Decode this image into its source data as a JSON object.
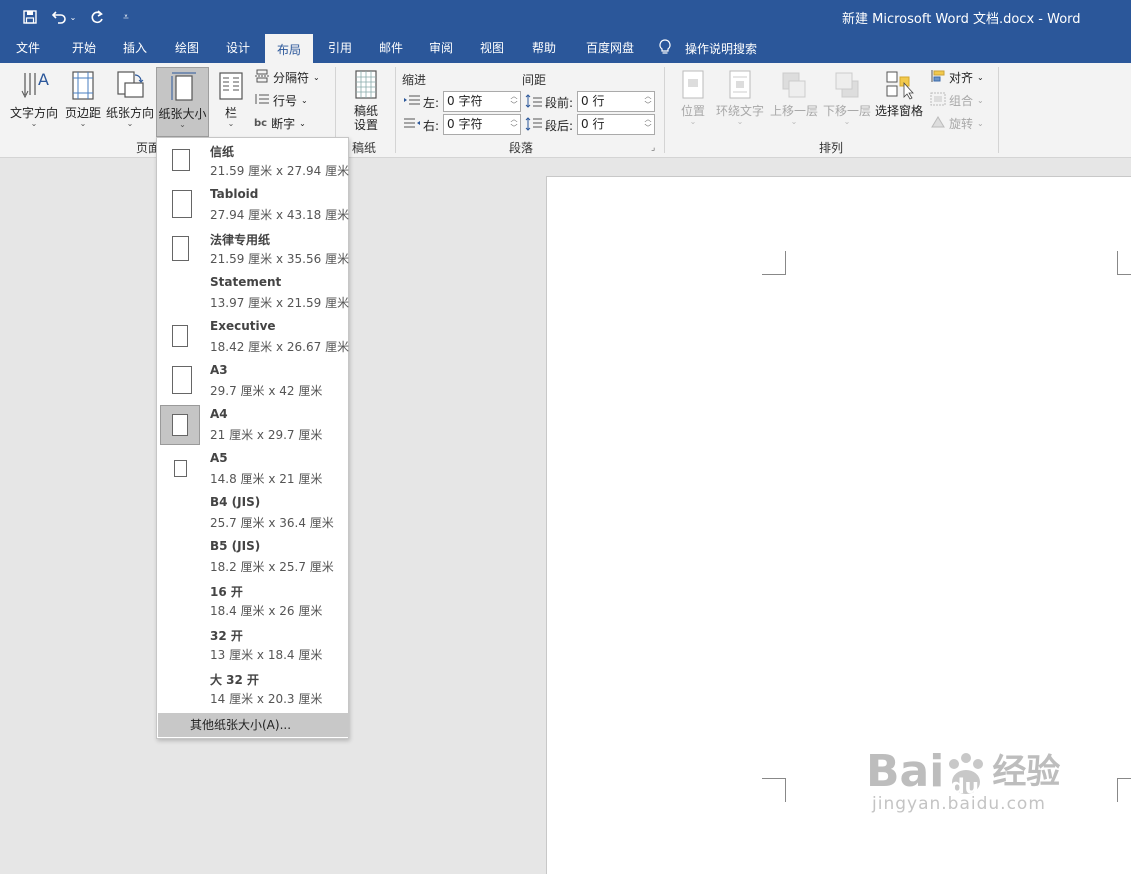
{
  "window": {
    "title": "新建 Microsoft Word 文档.docx - Word"
  },
  "qat": {
    "save_icon": "save-icon",
    "undo_icon": "undo-icon",
    "redo_icon": "redo-icon",
    "customize_icon": "customize-qat-icon"
  },
  "tabs": [
    {
      "label": "文件"
    },
    {
      "label": "开始"
    },
    {
      "label": "插入"
    },
    {
      "label": "绘图"
    },
    {
      "label": "设计"
    },
    {
      "label": "布局",
      "active": true
    },
    {
      "label": "引用"
    },
    {
      "label": "邮件"
    },
    {
      "label": "审阅"
    },
    {
      "label": "视图"
    },
    {
      "label": "帮助"
    },
    {
      "label": "百度网盘"
    }
  ],
  "tell_me": {
    "label": "操作说明搜索",
    "icon": "lightbulb-icon"
  },
  "ribbon": {
    "page_setup": {
      "group_label": "页面",
      "text_direction": "文字方向",
      "margins": "页边距",
      "orientation": "纸张方向",
      "size": "纸张大小",
      "columns": "栏",
      "breaks": "分隔符",
      "line_numbers": "行号",
      "hyphenation": "断字"
    },
    "manuscript": {
      "group_label": "稿纸",
      "button_line1": "稿纸",
      "button_line2": "设置"
    },
    "paragraph": {
      "group_label": "段落",
      "indent_header": "缩进",
      "spacing_header": "间距",
      "left_label": "左:",
      "left_value": "0 字符",
      "right_label": "右:",
      "right_value": "0 字符",
      "before_label": "段前:",
      "before_value": "0 行",
      "after_label": "段后:",
      "after_value": "0 行"
    },
    "arrange": {
      "group_label": "排列",
      "position": "位置",
      "wrap_text": "环绕文字",
      "bring_forward": "上移一层",
      "send_backward": "下移一层",
      "selection_pane": "选择窗格",
      "align": "对齐",
      "group": "组合",
      "rotate": "旋转"
    }
  },
  "paper_sizes": [
    {
      "name": "信纸",
      "dims": "21.59 厘米 x 27.94 厘米",
      "icon": true
    },
    {
      "name": "Tabloid",
      "dims": "27.94 厘米 x 43.18 厘米",
      "icon": true
    },
    {
      "name": "法律专用纸",
      "dims": "21.59 厘米 x 35.56 厘米",
      "icon": true
    },
    {
      "name": "Statement",
      "dims": "13.97 厘米 x 21.59 厘米",
      "icon": false
    },
    {
      "name": "Executive",
      "dims": "18.42 厘米 x 26.67 厘米",
      "icon": true
    },
    {
      "name": "A3",
      "dims": "29.7 厘米 x 42 厘米",
      "icon": true
    },
    {
      "name": "A4",
      "dims": "21 厘米 x 29.7 厘米",
      "icon": true,
      "selected": true
    },
    {
      "name": "A5",
      "dims": "14.8 厘米 x 21 厘米",
      "icon": true
    },
    {
      "name": "B4 (JIS)",
      "dims": "25.7 厘米 x 36.4 厘米",
      "icon": false
    },
    {
      "name": "B5 (JIS)",
      "dims": "18.2 厘米 x 25.7 厘米",
      "icon": false
    },
    {
      "name": "16 开",
      "dims": "18.4 厘米 x 26 厘米",
      "icon": false
    },
    {
      "name": "32 开",
      "dims": "13 厘米 x 18.4 厘米",
      "icon": false
    },
    {
      "name": "大 32 开",
      "dims": "14 厘米 x 20.3 厘米",
      "icon": false
    }
  ],
  "more_sizes": "其他纸张大小(A)...",
  "watermark": {
    "brand": "Bai",
    "brand2": "du",
    "brand_cn": "经验",
    "url": "jingyan.baidu.com"
  }
}
